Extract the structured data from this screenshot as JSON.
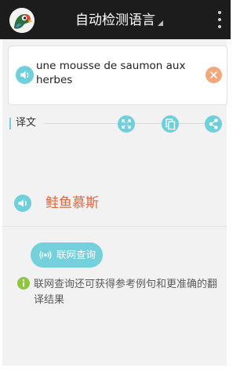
{
  "app": {
    "title": "自动检测语言",
    "logo_icon": "parrot-logo-icon",
    "menu_icon": "overflow-menu-icon"
  },
  "input": {
    "text": "une mousse de saumon aux herbes",
    "speak_icon": "speaker-icon",
    "clear_icon": "close-icon"
  },
  "result": {
    "label": "译文",
    "actions": [
      "fullscreen-icon",
      "copy-icon",
      "share-icon"
    ],
    "text": "鲑鱼慕斯",
    "speak_icon": "speaker-icon"
  },
  "online": {
    "button_label": "联网查询",
    "button_icon": "wifi-broadcast-icon",
    "info_icon": "info-icon",
    "info_text": "联网查询还可获得参考例句和更准确的翻译结果"
  },
  "colors": {
    "topbar": "#1c1c1c",
    "accent": "#6fd0db",
    "result_text": "#e0683f",
    "clear_button": "#f4a77c",
    "info_icon": "#8dc63f",
    "background": "#f2f2f2"
  }
}
